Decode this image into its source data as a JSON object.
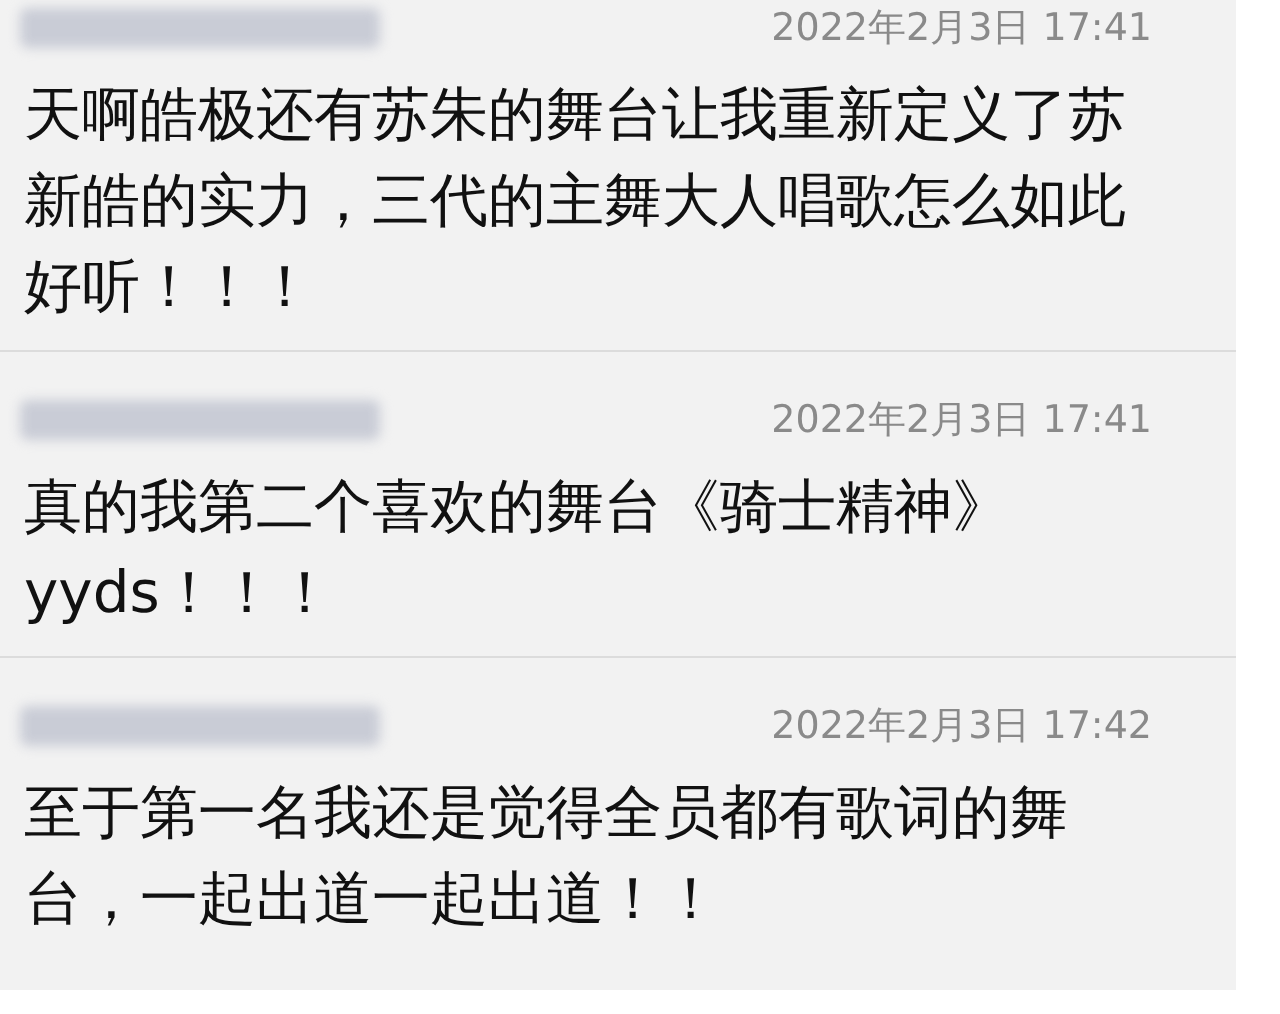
{
  "comments": [
    {
      "time": "2022年2月3日 17:41",
      "lines": [
        "天啊皓极还有苏朱的舞台让我重新定义了苏",
        "新皓的实力，三代的主舞大人唱歌怎么如此",
        "好听！！！"
      ]
    },
    {
      "time": "2022年2月3日 17:41",
      "lines": [
        "真的我第二个喜欢的舞台《骑士精神》",
        "yyds！！！"
      ]
    },
    {
      "time": "2022年2月3日 17:42",
      "lines": [
        "至于第一名我还是觉得全员都有歌词的舞",
        "台，一起出道一起出道！！"
      ]
    }
  ]
}
